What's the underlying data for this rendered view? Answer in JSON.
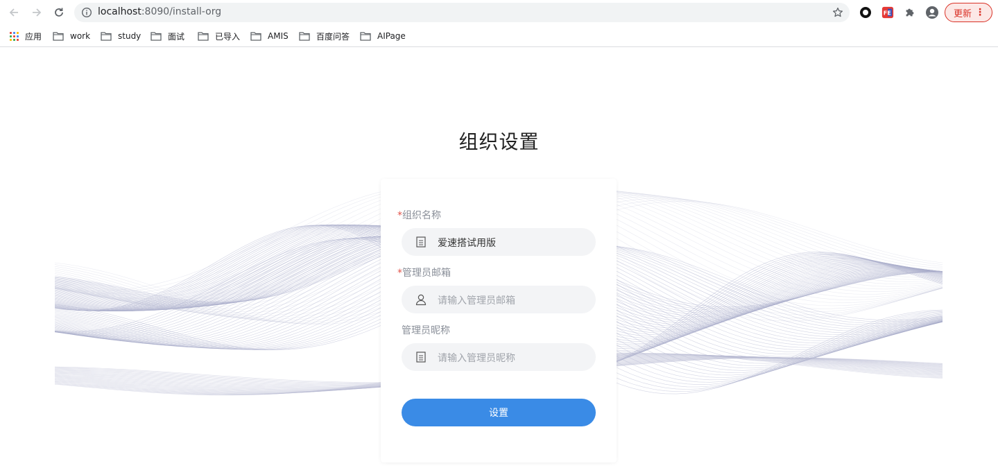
{
  "browser": {
    "url_host": "localhost",
    "url_path": ":8090/install-org",
    "update_label": "更新",
    "menu_glyph": "⋮",
    "bookmarks": [
      {
        "label": "应用",
        "icon": "apps-icon"
      },
      {
        "label": "work",
        "icon": "folder-icon"
      },
      {
        "label": "study",
        "icon": "folder-icon"
      },
      {
        "label": "面试",
        "icon": "folder-icon"
      },
      {
        "label": "已导入",
        "icon": "folder-icon"
      },
      {
        "label": "AMIS",
        "icon": "folder-icon"
      },
      {
        "label": "百度问答",
        "icon": "folder-icon"
      },
      {
        "label": "AIPage",
        "icon": "folder-icon"
      }
    ],
    "update_color": "#d93025"
  },
  "page": {
    "title": "组织设置",
    "form": {
      "org_name": {
        "required_mark": "*",
        "label": "组织名称",
        "value": "爱速搭试用版",
        "icon": "document-icon"
      },
      "admin_email": {
        "required_mark": "*",
        "label": "管理员邮箱",
        "placeholder": "请输入管理员邮箱",
        "icon": "user-icon"
      },
      "admin_nickname": {
        "label": "管理员昵称",
        "placeholder": "请输入管理员昵称",
        "icon": "document-icon"
      },
      "submit_label": "设置"
    },
    "colors": {
      "primary": "#3a8be6",
      "required": "#e2534a",
      "input_bg": "#f3f4f6"
    }
  }
}
